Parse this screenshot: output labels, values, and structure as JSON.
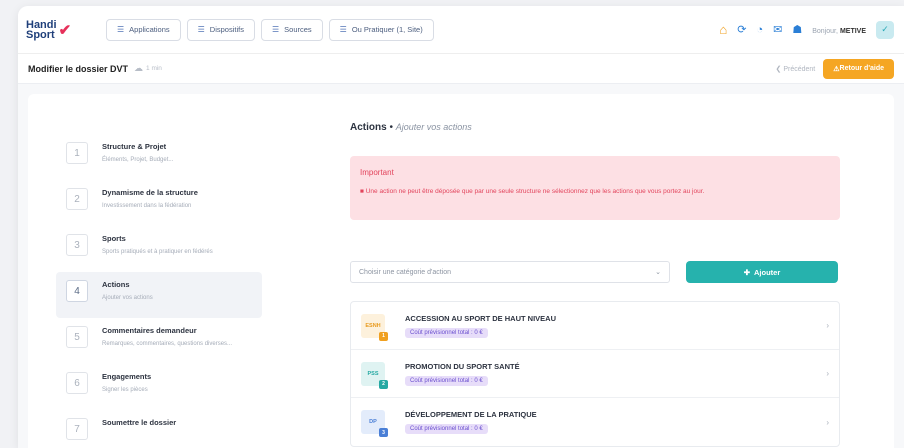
{
  "header": {
    "logo_text_1": "Handi",
    "logo_text_2": "Sport",
    "nav": [
      {
        "label": "Applications",
        "icon": "list-icon"
      },
      {
        "label": "Dispositifs",
        "icon": "list-icon"
      },
      {
        "label": "Sources",
        "icon": "list-icon"
      },
      {
        "label": "Ou Pratiquer (1, Site)",
        "icon": "list-icon"
      }
    ],
    "user_greeting": "Bonjour,",
    "user_name": "METIVE"
  },
  "subbar": {
    "title": "Modifier le dossier DVT",
    "saved": "1 min",
    "previous": "Précédent",
    "return_label": "Retour d'aide"
  },
  "steps": [
    {
      "num": "1",
      "title": "Structure & Projet",
      "sub": "Éléments, Projet, Budget..."
    },
    {
      "num": "2",
      "title": "Dynamisme de la structure",
      "sub": "Investissement dans la fédération"
    },
    {
      "num": "3",
      "title": "Sports",
      "sub": "Sports pratiqués et à pratiquer en fédérés"
    },
    {
      "num": "4",
      "title": "Actions",
      "sub": "Ajouter vos actions"
    },
    {
      "num": "5",
      "title": "Commentaires demandeur",
      "sub": "Remarques, commentaires, questions diverses..."
    },
    {
      "num": "6",
      "title": "Engagements",
      "sub": "Signer les pièces"
    },
    {
      "num": "7",
      "title": "Soumettre le dossier",
      "sub": ""
    }
  ],
  "main": {
    "heading": "Actions",
    "heading_sep": " • ",
    "heading_sub": "Ajouter vos actions",
    "alert_title": "Important",
    "alert_text": "■ Une action ne peut être déposée que par une seule structure ne sélectionnez que les actions que vous portez au jour.",
    "select_placeholder": "Choisir une catégorie d'action",
    "add_label": "Ajouter",
    "actions": [
      {
        "tile": "ESNH",
        "badge": "1",
        "title": "ACCESSION AU SPORT DE HAUT NIVEAU",
        "cost": "Coût prévisionnel total : 0 €",
        "tile_bg": "#fdf1dc",
        "tile_fg": "#e89a1c"
      },
      {
        "tile": "PSS",
        "badge": "2",
        "title": "PROMOTION DU SPORT SANTÉ",
        "cost": "Coût prévisionnel total : 0 €",
        "tile_bg": "#dff3f2",
        "tile_fg": "#26a9a3"
      },
      {
        "tile": "DP",
        "badge": "3",
        "title": "DÉVELOPPEMENT DE LA PRATIQUE",
        "cost": "Coût prévisionnel total : 0 €",
        "tile_bg": "#e3ecfb",
        "tile_fg": "#4a7fd6"
      }
    ]
  }
}
